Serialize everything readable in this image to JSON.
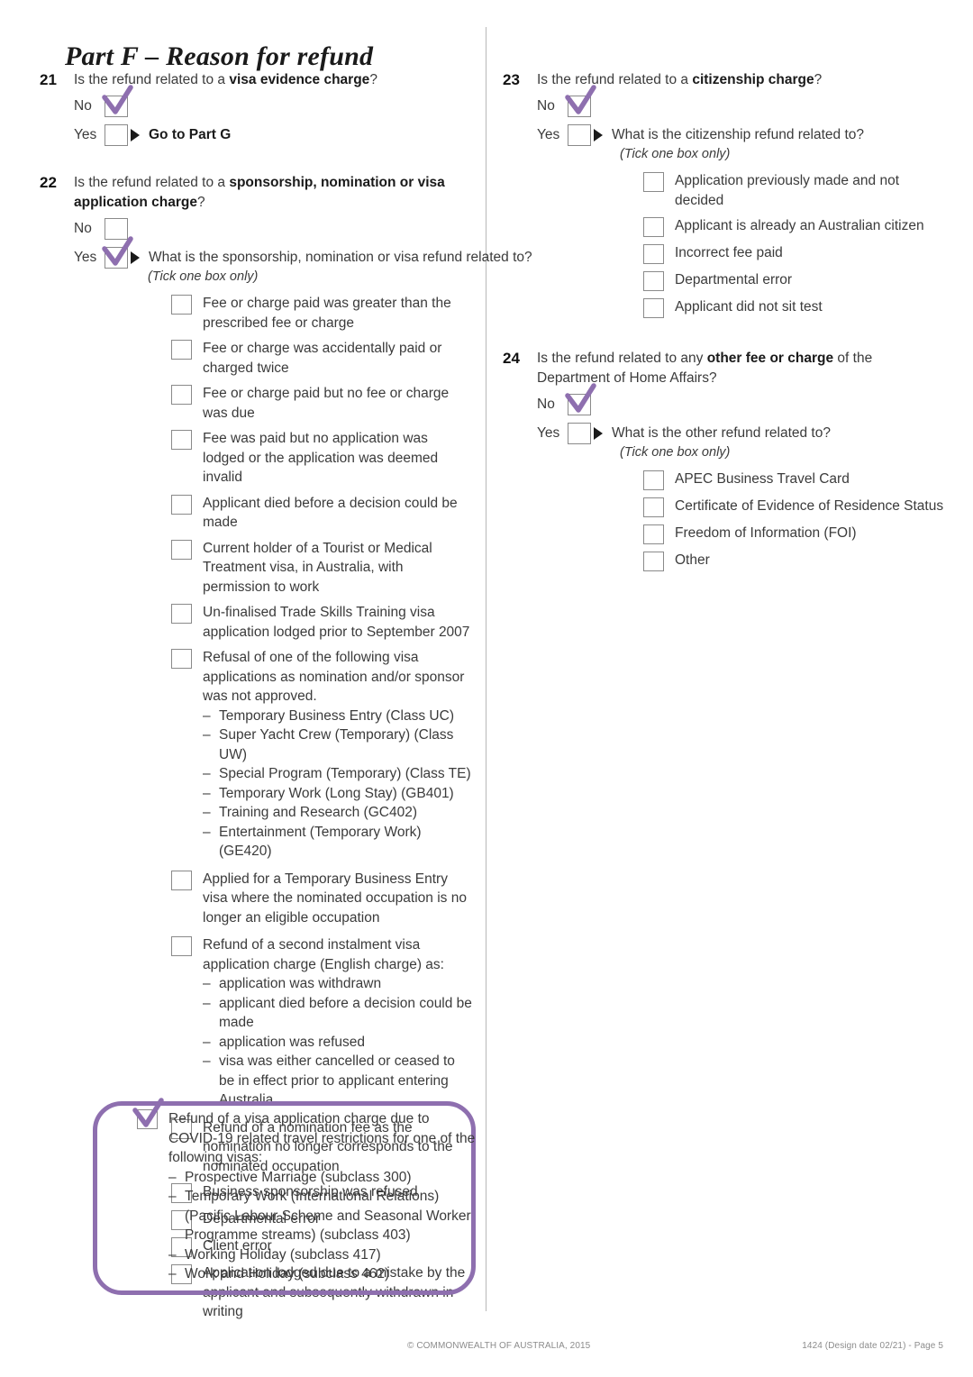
{
  "heading": "Part F – Reason for refund",
  "colors": {
    "tick_purple": "#8E6FAF",
    "highlight_purple": "#8E6FAF",
    "text": "#3b3b3b",
    "box_border": "#8a8a8a"
  },
  "labels": {
    "no": "No",
    "yes": "Yes",
    "tick_one_box_only": "(Tick one box only)"
  },
  "q21": {
    "number": "21",
    "text_before": "Is the refund related to a ",
    "text_bold": "visa evidence charge",
    "text_after": "?",
    "no_checked": true,
    "yes_checked": false,
    "yes_action": "Go to Part G"
  },
  "q22": {
    "number": "22",
    "text_before": "Is the refund related to a ",
    "text_bold": "sponsorship, nomination or visa application charge",
    "text_after": "?",
    "no_checked": false,
    "yes_checked": true,
    "branch_question": "What is the sponsorship, nomination or visa refund related to?",
    "options": [
      {
        "label": "Fee or charge paid was greater than the prescribed fee or charge",
        "checked": false
      },
      {
        "label": "Fee or charge was accidentally paid or charged twice",
        "checked": false
      },
      {
        "label": "Fee or charge paid but no fee or charge was due",
        "checked": false
      },
      {
        "label": "Fee was paid but no application was lodged or the application was deemed invalid",
        "checked": false
      },
      {
        "label": "Applicant died before a decision could be made",
        "checked": false
      },
      {
        "label": "Current holder of a Tourist or Medical Treatment visa, in Australia, with permission to work",
        "checked": false
      },
      {
        "label": "Un-finalised Trade Skills Training visa application lodged prior to September 2007",
        "checked": false
      },
      {
        "label": "Refusal of one of the following visa applications as nomination and/or sponsor was not approved.",
        "checked": false,
        "sub": [
          "Temporary Business Entry (Class UC)",
          "Super Yacht Crew (Temporary) (Class UW)",
          "Special Program (Temporary) (Class TE)",
          "Temporary Work (Long Stay) (GB401)",
          "Training and Research (GC402)",
          "Entertainment (Temporary Work) (GE420)"
        ]
      },
      {
        "label": "Applied for a Temporary Business Entry visa where the nominated occupation is no longer an eligible occupation",
        "checked": false
      },
      {
        "label": "Refund of a second instalment visa application charge (English charge) as:",
        "checked": false,
        "sub": [
          "application was withdrawn",
          "applicant died before a decision could be made",
          "application was refused",
          "visa was either cancelled or ceased to be in effect prior to applicant entering Australia"
        ]
      },
      {
        "label": "Refund of a nomination fee as the nomination no longer corresponds to the nominated occupation",
        "checked": false
      },
      {
        "label": "Business sponsorship was refused",
        "checked": false
      },
      {
        "label": "Departmental error",
        "checked": false
      },
      {
        "label": "Client error",
        "checked": false
      },
      {
        "label": "Application lodged due to a mistake by the applicant and subsequently withdrawn in writing",
        "checked": false
      }
    ],
    "covid_option": {
      "label": "Refund of a visa application charge due to COVID-19 related travel restrictions for one of the following visas:",
      "checked": true,
      "highlighted": true,
      "sub": [
        "Prospective Marriage (subclass 300)",
        "Temporary Work (International Relations) (Pacific Labour Scheme and Seasonal Worker Programme streams) (subclass 403)",
        "Working Holiday (subclass 417)",
        "Work and Holiday (subclass 462)"
      ]
    }
  },
  "q23": {
    "number": "23",
    "text_before": "Is the refund related to a ",
    "text_bold": "citizenship charge",
    "text_after": "?",
    "no_checked": true,
    "yes_checked": false,
    "branch_question": "What is the citizenship refund related to?",
    "options": [
      {
        "label": "Application previously made and not decided",
        "checked": false
      },
      {
        "label": "Applicant is already an Australian citizen",
        "checked": false
      },
      {
        "label": "Incorrect fee paid",
        "checked": false
      },
      {
        "label": "Departmental error",
        "checked": false
      },
      {
        "label": "Applicant did not sit test",
        "checked": false
      }
    ]
  },
  "q24": {
    "number": "24",
    "text_before": "Is the refund related to any ",
    "text_bold": "other fee or charge",
    "text_after": " of the Department of Home Affairs?",
    "no_checked": true,
    "yes_checked": false,
    "branch_question": "What is the other refund related to?",
    "options": [
      {
        "label": "APEC Business Travel Card",
        "checked": false
      },
      {
        "label": "Certificate of Evidence of Residence Status",
        "checked": false
      },
      {
        "label": "Freedom of Information (FOI)",
        "checked": false
      },
      {
        "label": "Other",
        "checked": false
      }
    ]
  },
  "footer": {
    "copyright": "© COMMONWEALTH OF AUSTRALIA, 2015",
    "form_info": "1424 (Design date 02/21) - Page 5"
  }
}
